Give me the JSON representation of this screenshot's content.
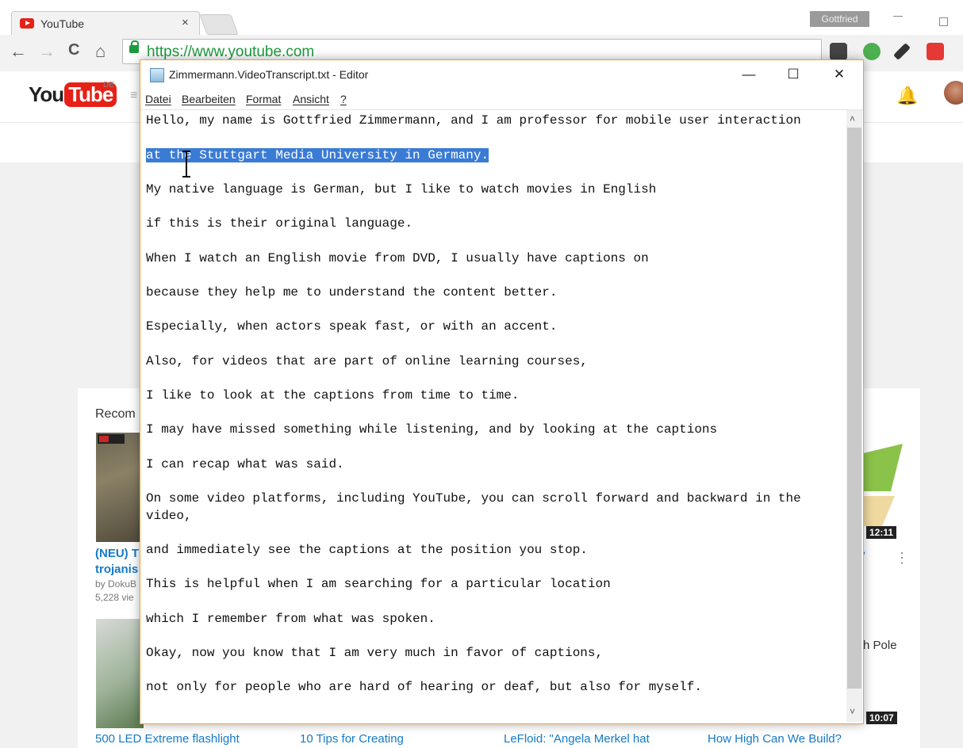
{
  "browser": {
    "tab_title": "YouTube",
    "tab_close": "×",
    "profile_name": "Gottfried",
    "url": "https://www.youtube.com",
    "nav": {
      "back": "←",
      "forward": "→",
      "reload": "C",
      "home": "⌂"
    }
  },
  "youtube": {
    "logo_you": "You",
    "logo_tube": "Tube",
    "logo_region": "DE",
    "recommended_label": "Recom",
    "videos": [
      {
        "title": "(NEU) T",
        "title_line2": "trojanis",
        "channel": "by DokuB",
        "views": "5,228 vie"
      },
      {
        "title": "500 LED Extreme flashlight"
      },
      {
        "title": "10 Tips for Creating"
      },
      {
        "title": "LeFloid: \"Angela Merkel hat"
      },
      {
        "title": "How High Can We Build?"
      }
    ],
    "durations": [
      "12:11",
      "10:07"
    ],
    "side_text": "h Pole",
    "kebab": "⋮",
    "dash": "ʼ"
  },
  "notepad": {
    "title": "Zimmermann.VideoTranscript.txt - Editor",
    "controls": {
      "minimize": "—",
      "maximize": "☐",
      "close": "✕"
    },
    "menu": [
      "Datei",
      "Bearbeiten",
      "Format",
      "Ansicht",
      "?"
    ],
    "scroll_up": "˄",
    "scroll_down": "˅",
    "lines": [
      "Hello, my name is Gottfried Zimmermann, and I am professor for mobile user interaction",
      "at the Stuttgart Media University in Germany.",
      "My native language is German, but I like to watch movies in English",
      "if this is their original language.",
      "When I watch an English movie from DVD, I usually have captions on",
      "because they help me to understand the content better.",
      "Especially, when actors speak fast, or with an accent.",
      "Also, for videos that are part of online learning courses,",
      "I like to look at the captions from time to time.",
      "I may have missed something while listening, and by looking at the captions",
      "I can recap what was said.",
      "On some video platforms, including YouTube, you can scroll forward and backward in the",
      "video,",
      "and immediately see the captions at the position you stop.",
      "This is helpful when I am searching for a particular location",
      "which I remember from what was spoken.",
      "Okay, now you know that I am very much in favor of captions,",
      "not only for people who are hard of hearing or deaf, but also for myself."
    ],
    "selected_line_index": 1
  }
}
